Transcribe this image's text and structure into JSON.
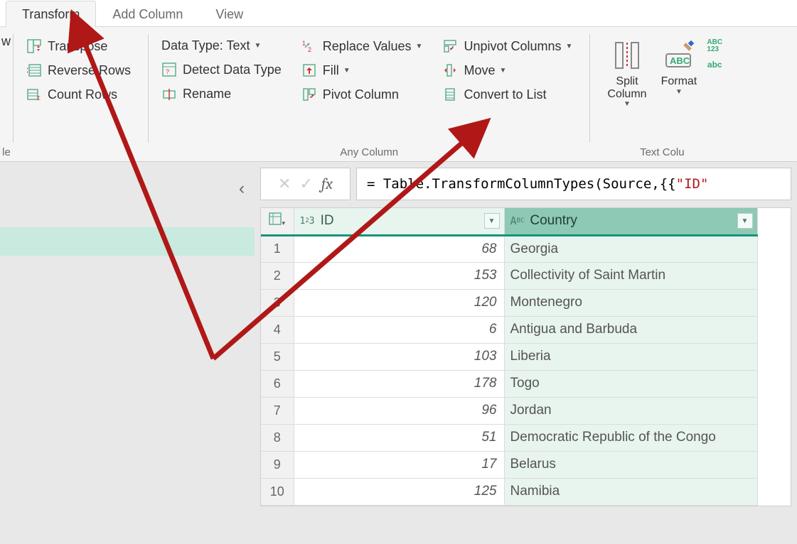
{
  "tabs": {
    "transform": "Transform",
    "add_column": "Add Column",
    "view": "View"
  },
  "ribbon": {
    "cutoff_left_letter": "w",
    "cutoff_left_group_label": "le",
    "table_group": {
      "transpose": "Transpose",
      "reverse_rows": "Reverse Rows",
      "count_rows": "Count Rows"
    },
    "any_column_group": {
      "label": "Any Column",
      "data_type": "Data Type: Text",
      "detect": "Detect Data Type",
      "rename": "Rename",
      "replace": "Replace Values",
      "fill": "Fill",
      "pivot": "Pivot Column",
      "unpivot": "Unpivot Columns",
      "move": "Move",
      "convert_to_list": "Convert to List"
    },
    "text_column_group": {
      "label": "Text Colu",
      "split_column": "Split\nColumn",
      "format": "Format",
      "abc123_icon": "ABC\n123",
      "abc_icon": "abc"
    }
  },
  "formula_bar": {
    "prefix": "= Table.TransformColumnTypes(Source,{{",
    "string_literal": "\"ID\""
  },
  "grid": {
    "columns": {
      "id": {
        "label": "ID",
        "type_icon": "1²3"
      },
      "country": {
        "label": "Country",
        "type_icon": "AᴮC"
      }
    },
    "rows": [
      {
        "n": 1,
        "id": 68,
        "country": "Georgia"
      },
      {
        "n": 2,
        "id": 153,
        "country": "Collectivity of Saint Martin"
      },
      {
        "n": 3,
        "id": 120,
        "country": "Montenegro"
      },
      {
        "n": 4,
        "id": 6,
        "country": "Antigua and Barbuda"
      },
      {
        "n": 5,
        "id": 103,
        "country": "Liberia"
      },
      {
        "n": 6,
        "id": 178,
        "country": "Togo"
      },
      {
        "n": 7,
        "id": 96,
        "country": "Jordan"
      },
      {
        "n": 8,
        "id": 51,
        "country": "Democratic Republic of the Congo"
      },
      {
        "n": 9,
        "id": 17,
        "country": "Belarus"
      },
      {
        "n": 10,
        "id": 125,
        "country": "Namibia"
      }
    ]
  }
}
